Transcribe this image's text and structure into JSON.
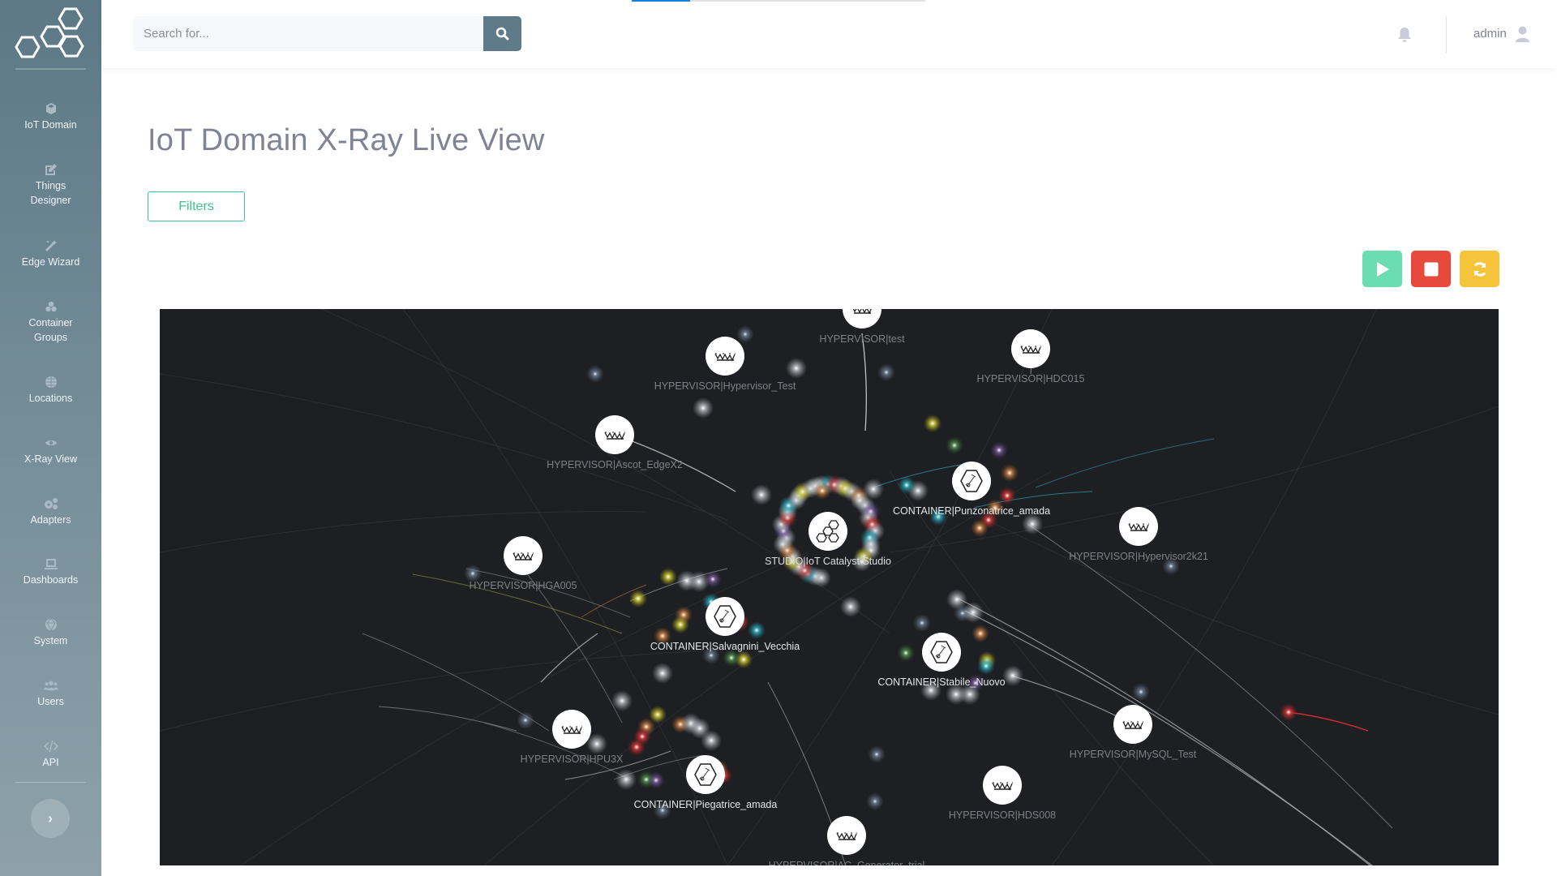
{
  "sidebar": {
    "items": [
      {
        "label": "IoT Domain",
        "icon": "cube-icon"
      },
      {
        "label": "Things Designer",
        "icon": "edit-icon"
      },
      {
        "label": "Edge Wizard",
        "icon": "magic-wand-icon"
      },
      {
        "label": "Container Groups",
        "icon": "cubes-icon"
      },
      {
        "label": "Locations",
        "icon": "globe-icon"
      },
      {
        "label": "X-Ray View",
        "icon": "eye-icon"
      },
      {
        "label": "Adapters",
        "icon": "cogs-icon"
      },
      {
        "label": "Dashboards",
        "icon": "laptop-icon"
      },
      {
        "label": "System",
        "icon": "system-icon"
      },
      {
        "label": "Users",
        "icon": "users-icon"
      },
      {
        "label": "API",
        "icon": "code-icon"
      }
    ],
    "collapse_label": "›"
  },
  "topbar": {
    "search_placeholder": "Search for...",
    "search_value": "",
    "loading_progress": 0.2,
    "user_name": "admin"
  },
  "page": {
    "title": "IoT Domain X-Ray Live View",
    "filters_label": "Filters"
  },
  "controls": {
    "play": "play-icon",
    "stop": "stop-icon",
    "refresh": "refresh-icon"
  },
  "colors": {
    "sidebar": "#5d7886",
    "accent_green": "#3cc58f",
    "play": "#6cdcb3",
    "stop": "#e7493d",
    "refresh": "#f5c43a",
    "graph_bg": "#1e1f22",
    "loadbar": "#1a7fd6"
  },
  "graph": {
    "nodes": [
      {
        "label": "HYPERVISOR|test",
        "type": "hypervisor"
      },
      {
        "label": "HYPERVISOR|Hypervisor_Test",
        "type": "hypervisor"
      },
      {
        "label": "HYPERVISOR|HDC015",
        "type": "hypervisor"
      },
      {
        "label": "HYPERVISOR|Ascot_EdgeX2",
        "type": "hypervisor"
      },
      {
        "label": "CONTAINER|Punzonatrice_amada",
        "type": "container"
      },
      {
        "label": "STUDIO|IoT Catalyst Studio",
        "type": "studio"
      },
      {
        "label": "HYPERVISOR|Hypervisor2k21",
        "type": "hypervisor"
      },
      {
        "label": "HYPERVISOR|HGA005",
        "type": "hypervisor"
      },
      {
        "label": "CONTAINER|Salvagnini_Vecchia",
        "type": "container"
      },
      {
        "label": "CONTAINER|Stabile_Nuovo",
        "type": "container"
      },
      {
        "label": "HYPERVISOR|HPU3X",
        "type": "hypervisor"
      },
      {
        "label": "HYPERVISOR|MySQL_Test",
        "type": "hypervisor"
      },
      {
        "label": "CONTAINER|Piegatrice_amada",
        "type": "container"
      },
      {
        "label": "HYPERVISOR|HDS008",
        "type": "hypervisor"
      },
      {
        "label": "HYPERVISOR|AC_Generator_trial",
        "type": "hypervisor"
      }
    ]
  }
}
